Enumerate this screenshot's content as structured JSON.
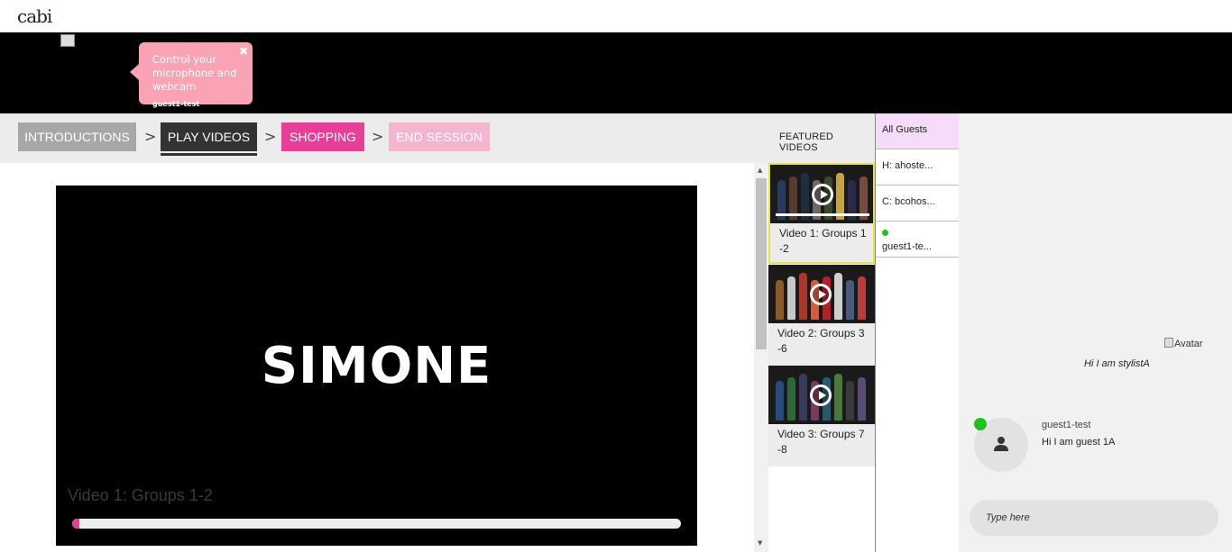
{
  "brand": {
    "logo": "cabi"
  },
  "header": {
    "tooltip_text": "Control your microphone and webcam",
    "tooltip_close": "✖",
    "guest_tag": "guest1-test"
  },
  "steps": {
    "items": [
      {
        "label": "INTRODUCTIONS",
        "state": "done"
      },
      {
        "label": "PLAY VIDEOS",
        "state": "active"
      },
      {
        "label": "SHOPPING",
        "state": "next"
      },
      {
        "label": "END SESSION",
        "state": "disabled"
      }
    ],
    "separator": ">",
    "featured_label": "FEATURED VIDEOS"
  },
  "player": {
    "logo_text": "SIMONE",
    "title": "Video 1: Groups 1-2",
    "progress": 0.01
  },
  "videos": [
    {
      "title": "Video 1: Groups 1 -2",
      "active": true
    },
    {
      "title": "Video 2: Groups 3 -6",
      "active": false
    },
    {
      "title": "Video 3: Groups 7 -8",
      "active": false
    }
  ],
  "guests": {
    "tabs": [
      {
        "label": "All Guests"
      },
      {
        "label": "H: ahoste..."
      },
      {
        "label": "C: bcohos..."
      },
      {
        "label": "guest1-te...",
        "online": true
      }
    ]
  },
  "chat": {
    "host_avatar_alt": "Avatar",
    "host_message": "Hi I am stylistA",
    "guest_name": "guest1-test",
    "guest_message": "Hi I am guest 1A",
    "input_placeholder": "Type here"
  },
  "colors": {
    "accent_pink": "#e73e97",
    "tooltip_pink": "#f9a3b4",
    "online_green": "#1fc11f",
    "active_outline": "#e4e44a"
  }
}
